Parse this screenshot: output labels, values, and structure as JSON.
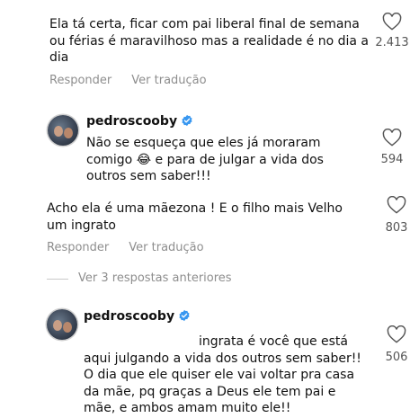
{
  "comments": [
    {
      "text": "Ela tá certa, ficar com pai liberal final de semana ou férias é maravilhoso mas a realidade é no dia a dia",
      "likes": "2.413",
      "reply_label": "Responder",
      "translate_label": "Ver tradução"
    },
    {
      "username": "pedroscooby",
      "text": "Não se esqueça que eles já moraram comigo 😂 e para de julgar a vida dos outros sem saber!!!",
      "likes": "594"
    },
    {
      "text": "Acho ela é uma mãezona ! E o filho mais Velho um ingrato",
      "likes": "803",
      "reply_label": "Responder",
      "translate_label": "Ver tradução"
    },
    {
      "view_replies_label": "Ver 3 respostas anteriores"
    },
    {
      "username": "pedroscooby",
      "text": "ingrata é você que está aqui julgando a vida dos outros sem saber!! O dia que ele quiser ele vai voltar pra casa da mãe, pq graças a Deus ele tem pai e mãe, e ambos amam muito ele!!",
      "likes": "506"
    }
  ],
  "icons": {
    "like": "heart-outline-icon",
    "verified": "verified-badge-icon",
    "avatar": "profile-avatar"
  },
  "colors": {
    "verified": "#3897f0",
    "muted": "#8e8e8e"
  }
}
